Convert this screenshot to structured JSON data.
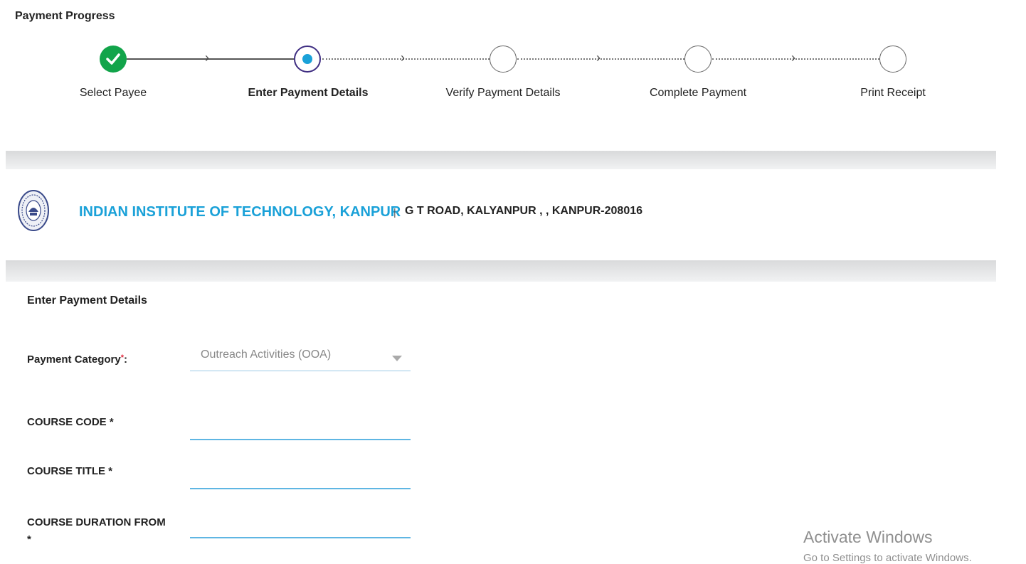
{
  "progress": {
    "title": "Payment Progress",
    "steps": [
      {
        "label": "Select Payee",
        "status": "completed"
      },
      {
        "label": "Enter Payment Details",
        "status": "current"
      },
      {
        "label": "Verify Payment Details",
        "status": "pending"
      },
      {
        "label": "Complete Payment",
        "status": "pending"
      },
      {
        "label": "Print Receipt",
        "status": "pending"
      }
    ]
  },
  "institute": {
    "name": "INDIAN INSTITUTE OF TECHNOLOGY, KANPUR",
    "separator": "|",
    "address": "G T ROAD, KALYANPUR , , KANPUR-208016"
  },
  "form": {
    "title": "Enter Payment Details",
    "payment_category": {
      "label": "Payment Category",
      "required_mark": "*",
      "suffix": ":",
      "value": "Outreach Activities (OOA)"
    },
    "fields": [
      {
        "label": "COURSE CODE *",
        "value": ""
      },
      {
        "label": "COURSE TITLE *",
        "value": ""
      },
      {
        "label": "COURSE DURATION FROM",
        "label_extra": "*",
        "value": ""
      }
    ]
  },
  "watermark": {
    "title": "Activate Windows",
    "subtitle": "Go to Settings to activate Windows."
  },
  "colors": {
    "accent": "#1aa1d8",
    "completed": "#12a44a",
    "current_ring": "#3f2e82",
    "required": "#e0263a"
  }
}
